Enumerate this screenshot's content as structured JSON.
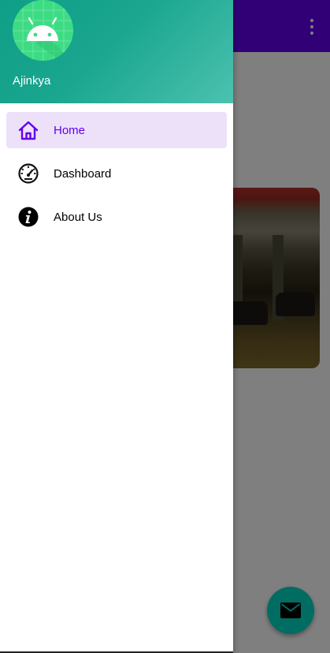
{
  "background_app": {
    "overflow_menu_icon": "more-vert-icon",
    "fab_icon": "email-icon",
    "photo_description_icon": "parking-garage-photo"
  },
  "drawer": {
    "header": {
      "avatar_icon": "android-logo-icon",
      "user_name": "Ajinkya"
    },
    "items": [
      {
        "label": "Home",
        "icon": "home-icon",
        "selected": true
      },
      {
        "label": "Dashboard",
        "icon": "dashboard-icon",
        "selected": false
      },
      {
        "label": "About Us",
        "icon": "info-icon",
        "selected": false
      }
    ]
  },
  "colors": {
    "primary": "#6200ee",
    "header_teal": "#0f9e87",
    "fab": "#03dac5",
    "selected_bg": "#ede1f9",
    "android_green": "#3ddc84"
  }
}
